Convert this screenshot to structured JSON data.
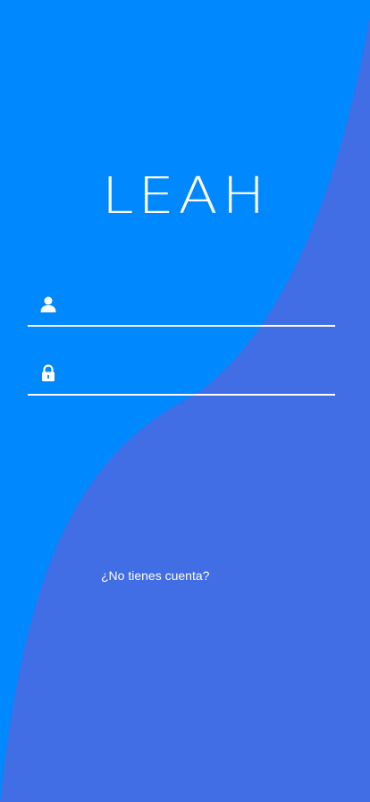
{
  "app": {
    "logo_text": "LEAH"
  },
  "login_form": {
    "username": {
      "icon": "user-icon",
      "value": "",
      "placeholder": ""
    },
    "password": {
      "icon": "lock-icon",
      "value": "",
      "placeholder": ""
    }
  },
  "signup": {
    "link_text": "¿No tienes cuenta?"
  },
  "colors": {
    "background": "#0088ff",
    "wave": "#416ee4",
    "text": "#ffffff"
  }
}
